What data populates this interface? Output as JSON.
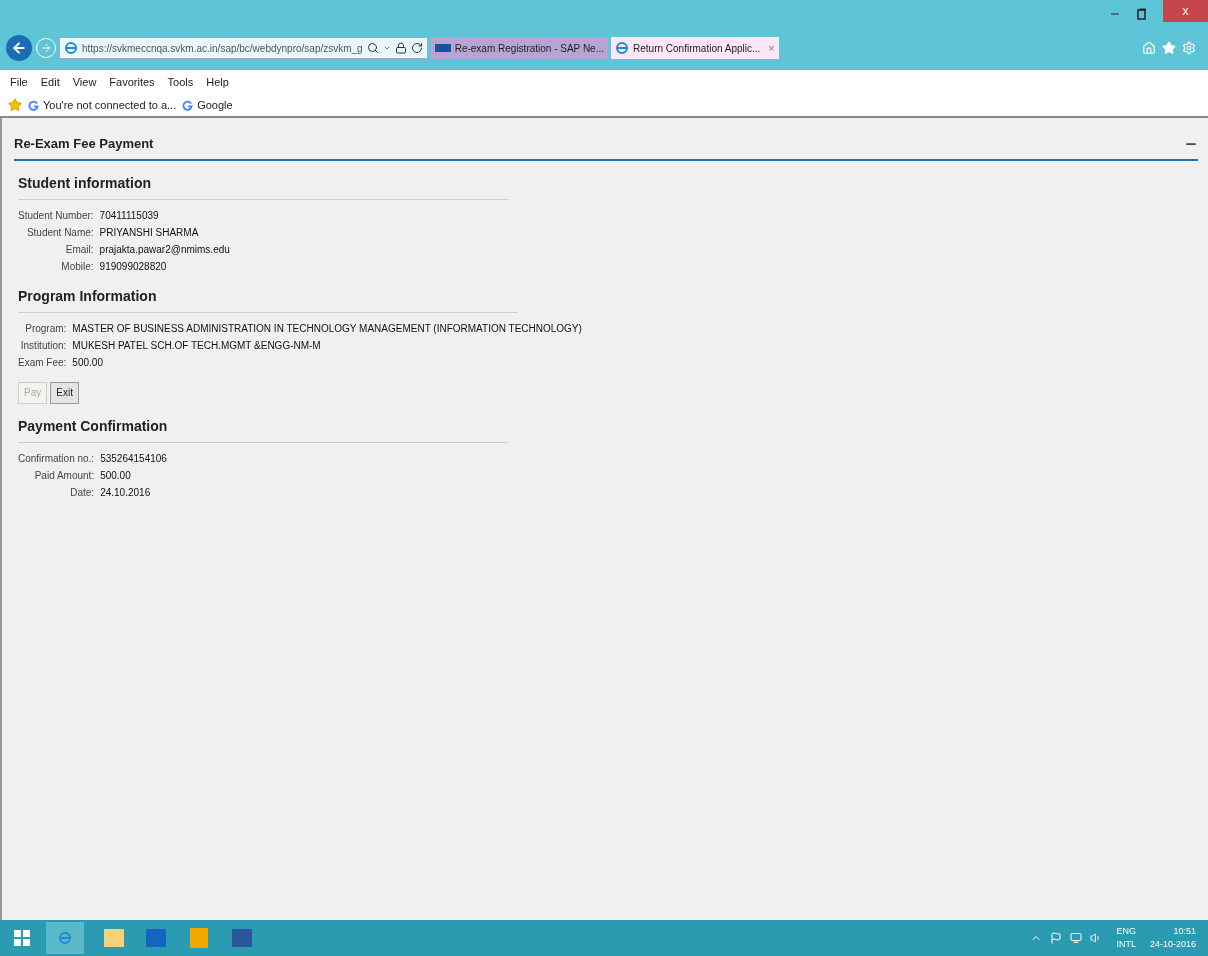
{
  "browser": {
    "address": "https://svkmeccnqa.svkm.ac.in/sap/bc/webdynpro/sap/zsvkm_g",
    "tabs": [
      {
        "label": "Re-exam Registration - SAP Ne...",
        "selected": false
      },
      {
        "label": "Return Confirmation Applic...",
        "selected": true,
        "close_glyph": "×"
      }
    ],
    "window_close": "x",
    "menu": [
      "File",
      "Edit",
      "View",
      "Favorites",
      "Tools",
      "Help"
    ],
    "favorites": [
      "You're not connected to a...",
      "Google"
    ]
  },
  "page": {
    "title": "Re-Exam Fee Payment",
    "sections": [
      {
        "title": "Student information",
        "fields": [
          {
            "label": "Student Number:",
            "value": "70411115039"
          },
          {
            "label": "Student Name:",
            "value": "PRIYANSHI SHARMA"
          },
          {
            "label": "Email:",
            "value": "prajakta.pawar2@nmims.edu"
          },
          {
            "label": "Mobile:",
            "value": "919099028820"
          }
        ]
      },
      {
        "title": "Program Information",
        "fields": [
          {
            "label": "Program:",
            "value": "MASTER OF BUSINESS ADMINISTRATION IN TECHNOLOGY MANAGEMENT (INFORMATION TECHNOLOGY)"
          },
          {
            "label": "Institution:",
            "value": "MUKESH PATEL SCH.OF TECH.MGMT &ENGG-NM-M"
          },
          {
            "label": "Exam Fee:",
            "value": "500.00"
          }
        ],
        "buttons": [
          {
            "label": "Pay",
            "disabled": true
          },
          {
            "label": "Exit",
            "disabled": false
          }
        ]
      },
      {
        "title": "Payment Confirmation",
        "fields": [
          {
            "label": "Confirmation no.:",
            "value": "535264154106"
          },
          {
            "label": "Paid Amount:",
            "value": "500.00"
          },
          {
            "label": "Date:",
            "value": "24.10.2016"
          }
        ]
      }
    ]
  },
  "taskbar": {
    "language": "ENG",
    "layout": "INTL",
    "time": "10:51",
    "date": "24-10-2016"
  }
}
